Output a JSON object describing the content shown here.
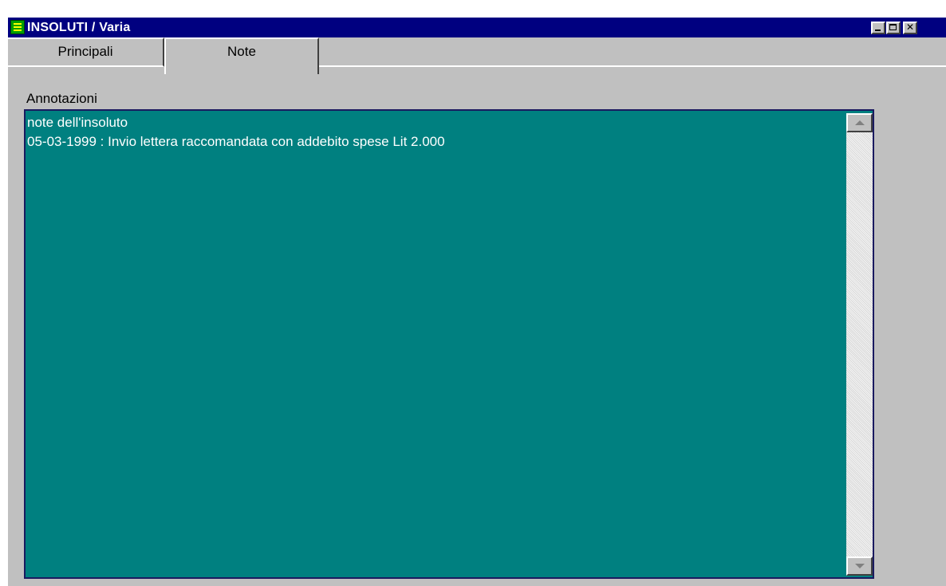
{
  "window": {
    "title": "INSOLUTI / Varia",
    "icon": "app-window-icon",
    "controls": [
      "minimize-icon",
      "maximize-icon",
      "close-icon"
    ]
  },
  "tabs": [
    {
      "label": "Principali",
      "active": false
    },
    {
      "label": "Note",
      "active": true
    }
  ],
  "notes": {
    "label": "Annotazioni",
    "value": "note dell'insoluto\n05-03-1999 : Invio lettera raccomandata con addebito spese Lit 2.000"
  },
  "colors": {
    "titlebar": "#000080",
    "notes_background": "#008080",
    "window_background": "#c0c0c0"
  }
}
